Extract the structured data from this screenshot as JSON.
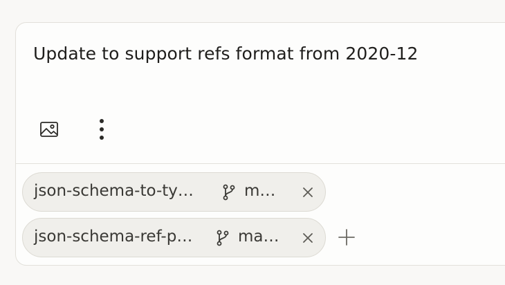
{
  "prompt": {
    "text": "Update to support refs format from 2020-12"
  },
  "toolbar": {
    "image_icon": "image-icon",
    "more_icon": "more-vertical-icon"
  },
  "repos": [
    {
      "repo": "json-schema-to-ty…",
      "branch": "m…",
      "branch_icon": "git-branch-icon",
      "remove_icon": "close-icon"
    },
    {
      "repo": "json-schema-ref-p…",
      "branch": "ma…",
      "branch_icon": "git-branch-icon",
      "remove_icon": "close-icon"
    }
  ],
  "add_icon": "plus-icon",
  "colors": {
    "background": "#f9f8f6",
    "card": "#fdfdfc",
    "chip": "#f0efeb",
    "text": "#1f1e1c"
  }
}
